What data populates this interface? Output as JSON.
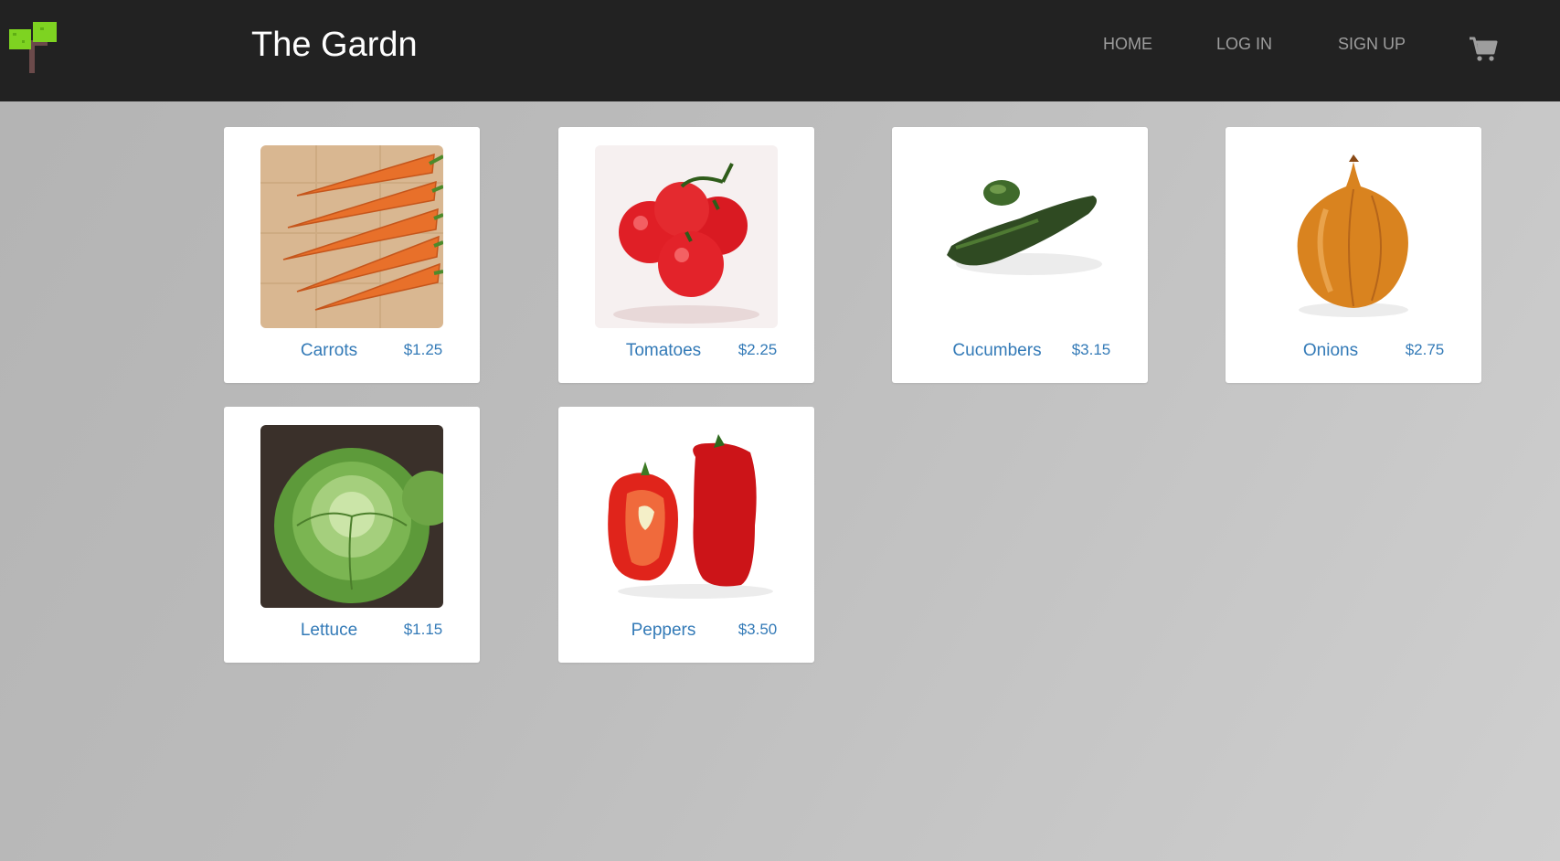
{
  "brand": {
    "name": "The Gardn"
  },
  "nav": {
    "home": "HOME",
    "login": "LOG IN",
    "signup": "SIGN UP",
    "cart_icon": "shopping-cart-icon"
  },
  "colors": {
    "navbar_bg": "#222222",
    "link": "#337ab7",
    "nav_text": "#9d9d9d"
  },
  "products": [
    {
      "name": "Carrots",
      "price": "$1.25",
      "image": "carrots-image"
    },
    {
      "name": "Tomatoes",
      "price": "$2.25",
      "image": "tomatoes-image"
    },
    {
      "name": "Cucumbers",
      "price": "$3.15",
      "image": "cucumbers-image"
    },
    {
      "name": "Onions",
      "price": "$2.75",
      "image": "onion-image"
    },
    {
      "name": "Lettuce",
      "price": "$1.15",
      "image": "lettuce-image"
    },
    {
      "name": "Peppers",
      "price": "$3.50",
      "image": "peppers-image"
    }
  ]
}
